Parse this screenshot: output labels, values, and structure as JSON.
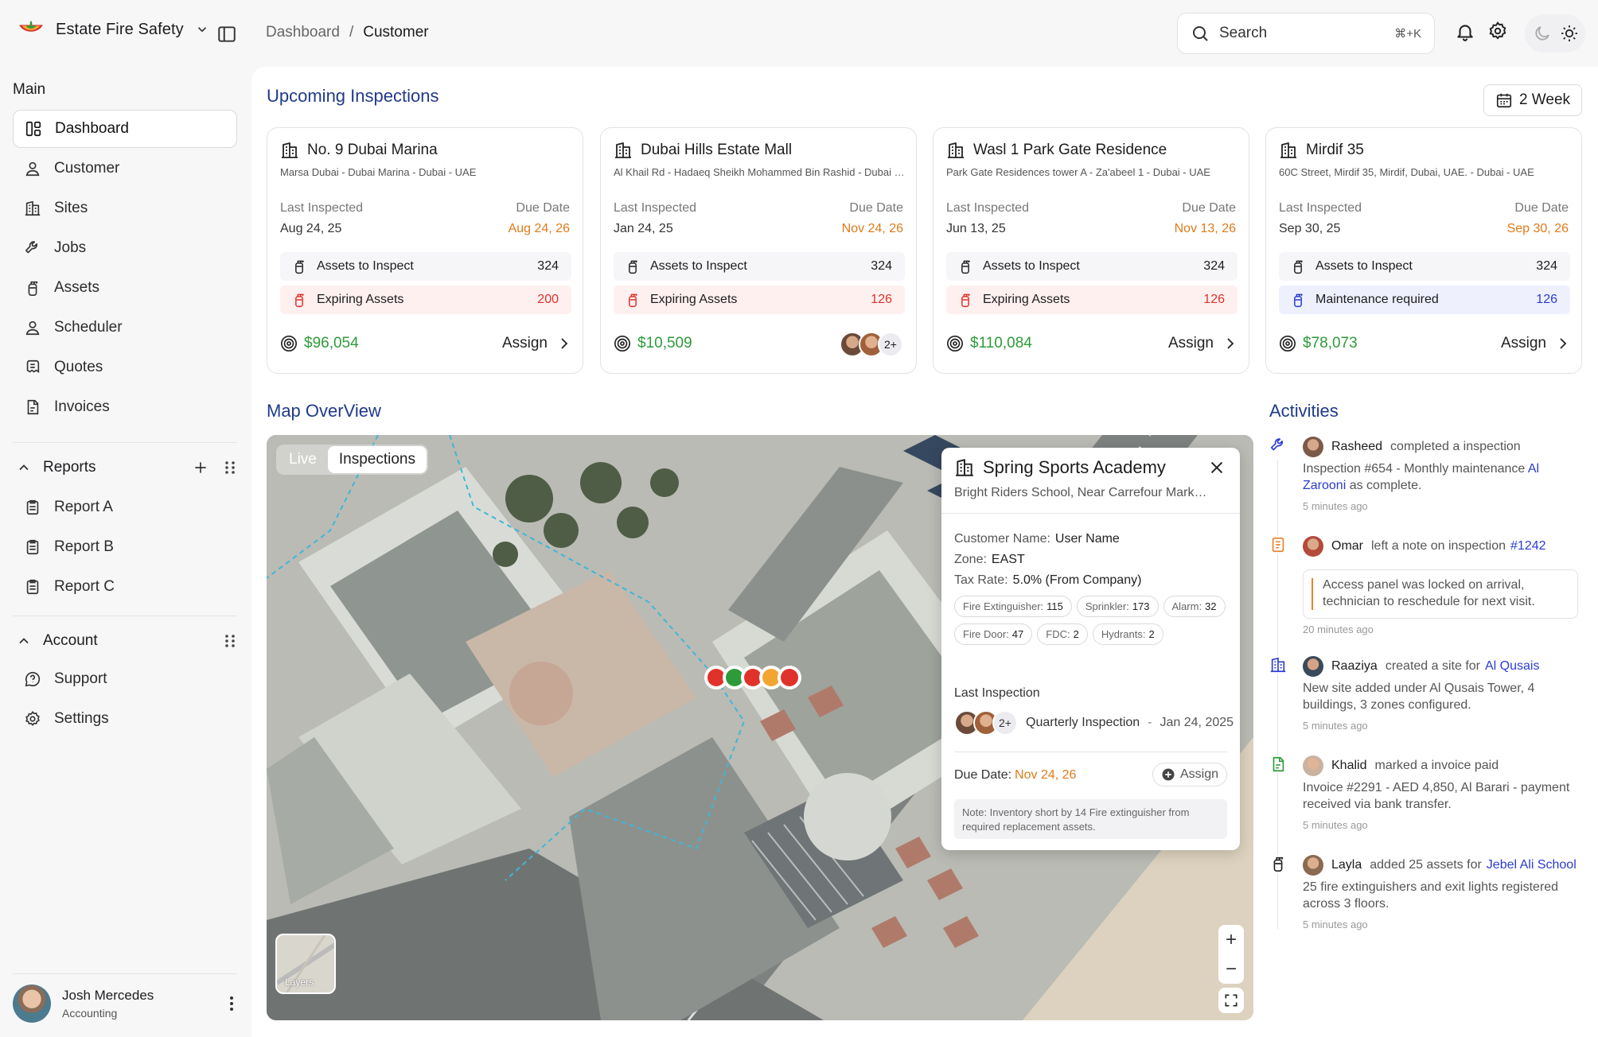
{
  "app": {
    "name": "Estate Fire Safety"
  },
  "breadcrumb": {
    "root": "Dashboard",
    "sep": "/",
    "current": "Customer"
  },
  "search": {
    "placeholder": "Search",
    "shortcut": "⌘+K"
  },
  "sidebar": {
    "main_heading": "Main",
    "items": [
      {
        "label": "Dashboard",
        "icon": "dashboard-icon",
        "active": true
      },
      {
        "label": "Customer",
        "icon": "user-icon"
      },
      {
        "label": "Sites",
        "icon": "building-icon"
      },
      {
        "label": "Jobs",
        "icon": "wrench-icon"
      },
      {
        "label": "Assets",
        "icon": "extinguisher-icon"
      },
      {
        "label": "Scheduler",
        "icon": "user-icon"
      },
      {
        "label": "Quotes",
        "icon": "quote-icon"
      },
      {
        "label": "Invoices",
        "icon": "invoice-icon"
      }
    ],
    "reports_heading": "Reports",
    "reports": [
      "Report A",
      "Report B",
      "Report C"
    ],
    "account_heading": "Account",
    "account_items": [
      "Support",
      "Settings"
    ],
    "user": {
      "name": "Josh Mercedes",
      "role": "Accounting"
    }
  },
  "upcoming": {
    "title": "Upcoming Inspections",
    "range_button": "2 Week",
    "cards": [
      {
        "title": "No. 9 Dubai Marina",
        "address": "Marsa Dubai - Dubai Marina - Dubai - UAE",
        "last_label": "Last Inspected",
        "last": "Aug 24, 25",
        "due_label": "Due Date",
        "due": "Aug 24, 26",
        "row1_label": "Assets to Inspect",
        "row1_value": "324",
        "row2_label": "Expiring Assets",
        "row2_value": "200",
        "price": "$96,054",
        "assign": "Assign"
      },
      {
        "title": "Dubai Hills Estate Mall",
        "address": "Al Khail Rd - Hadaeq Sheikh Mohammed Bin Rashid - Dubai - UAE",
        "last_label": "Last Inspected",
        "last": "Jan 24, 25",
        "due_label": "Due Date",
        "due": "Nov 24, 26",
        "row1_label": "Assets to Inspect",
        "row1_value": "324",
        "row2_label": "Expiring Assets",
        "row2_value": "126",
        "price": "$10,509",
        "more": "2+"
      },
      {
        "title": "Wasl 1 Park Gate Residence",
        "address": "Park Gate Residences tower A - Za'abeel 1 - Dubai - UAE",
        "last_label": "Last Inspected",
        "last": "Jun 13, 25",
        "due_label": "Due Date",
        "due": "Nov 13, 26",
        "row1_label": "Assets to Inspect",
        "row1_value": "324",
        "row2_label": "Expiring Assets",
        "row2_value": "126",
        "price": "$110,084",
        "assign": "Assign"
      },
      {
        "title": "Mirdif 35",
        "address": "60C Street, Mirdif 35, Mirdif, Dubai, UAE. - Dubai - UAE",
        "last_label": "Last Inspected",
        "last": "Sep 30, 25",
        "due_label": "Due Date",
        "due": "Sep 30, 26",
        "row1_label": "Assets to Inspect",
        "row1_value": "324",
        "row2_label": "Maintenance required",
        "row2_value": "126",
        "price": "$78,073",
        "assign": "Assign"
      }
    ]
  },
  "map": {
    "title": "Map OverView",
    "tabs": [
      "Live",
      "Inspections"
    ],
    "layers_label": "Layers",
    "popup": {
      "title": "Spring Sports Academy",
      "subtitle": "Bright Riders School, Near Carrefour Market, Al Barsha",
      "customer_label": "Customer Name:",
      "customer": "User Name",
      "zone_label": "Zone:",
      "zone": "EAST",
      "tax_label": "Tax Rate:",
      "tax": "5.0% (From Company)",
      "chips": [
        {
          "label": "Fire Extinguisher:",
          "value": "115"
        },
        {
          "label": "Sprinkler:",
          "value": "173"
        },
        {
          "label": "Alarm:",
          "value": "32"
        },
        {
          "label": "Fire Door:",
          "value": "47"
        },
        {
          "label": "FDC:",
          "value": "2"
        },
        {
          "label": "Hydrants:",
          "value": "2"
        }
      ],
      "last_inspection_label": "Last Inspection",
      "more": "2+",
      "inspection_name": "Quarterly Inspection",
      "inspection_sep": "-",
      "inspection_date": "Jan 24, 2025",
      "due_label": "Due Date:",
      "due": "Nov 24, 26",
      "assign": "Assign",
      "note": "Note: Inventory short by 14 Fire extinguisher from required replacement assets."
    }
  },
  "activities": {
    "title": "Activities",
    "items": [
      {
        "user": "Rasheed",
        "action": "completed a inspection",
        "link": "",
        "body_pre": "Inspection #654 - Monthly maintenance ",
        "body_link": "Al Zarooni",
        "body_post": " as complete.",
        "time": "5 minutes ago",
        "icon": "wrench-icon"
      },
      {
        "user": "Omar",
        "action": "left a note on inspection",
        "link": "#1242",
        "quote": "Access panel was locked on arrival, technician to reschedule for next visit.",
        "time": "20 minutes ago",
        "icon": "note-icon"
      },
      {
        "user": "Raaziya",
        "action": "created a site for",
        "link": "Al Qusais",
        "body_pre": "New site added under Al Qusais Tower, 4 buildings, 3 zones configured.",
        "time": "5 minutes ago",
        "icon": "building-icon"
      },
      {
        "user": "Khalid",
        "action": "marked a invoice paid",
        "link": "",
        "body_pre": "Invoice #2291 - AED 4,850, Al Barari - payment received via bank transfer.",
        "time": "5 minutes ago",
        "icon": "invoice-icon"
      },
      {
        "user": "Layla",
        "action": "added 25 assets for",
        "link": "Jebel Ali School",
        "body_pre": "25 fire extinguishers and exit lights registered across 3 floors.",
        "time": "5 minutes ago",
        "icon": "extinguisher-icon"
      }
    ]
  },
  "colors": {
    "accent": "#1f3a8a",
    "due": "#e07a1a",
    "money": "#2e9b3a",
    "danger": "#e0322a",
    "link": "#2a3ccf"
  }
}
